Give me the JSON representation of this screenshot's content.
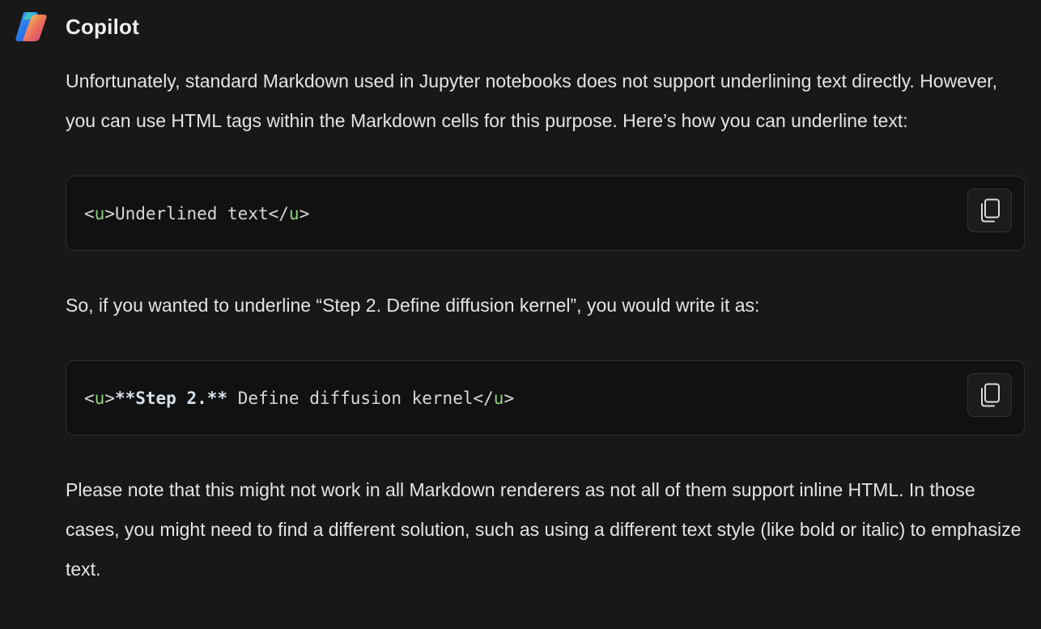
{
  "header": {
    "title": "Copilot"
  },
  "icons": {
    "logo": "copilot-logo-icon",
    "copy": "copy-icon"
  },
  "message": {
    "intro": "Unfortunately, standard Markdown used in Jupyter notebooks does not support underlining text directly. However, you can use HTML tags within the Markdown cells for this purpose. Here’s how you can underline text:",
    "code1": {
      "open_bracket": "<",
      "open_tag": "u",
      "open_close": ">",
      "content": "Underlined text",
      "close_bracket": "</",
      "close_tag": "u",
      "close_end": ">"
    },
    "middle": "So, if you wanted to underline “Step 2. Define diffusion kernel”, you would write it as:",
    "code2": {
      "open_bracket": "<",
      "open_tag": "u",
      "open_close": ">",
      "bold_part": "**Step 2.**",
      "content": " Define diffusion kernel",
      "close_bracket": "</",
      "close_tag": "u",
      "close_end": ">"
    },
    "outro": "Please note that this might not work in all Markdown renderers as not all of them support inline HTML. In those cases, you might need to find a different solution, such as using a different text style (like bold or italic) to emphasize text."
  },
  "colors": {
    "background": "#181818",
    "code_background": "#111111",
    "tag_green": "#8fd07a"
  }
}
